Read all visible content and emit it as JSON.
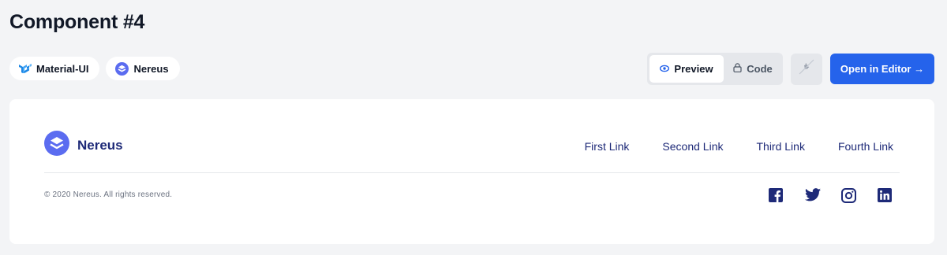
{
  "page": {
    "title": "Component #4"
  },
  "chips": [
    {
      "label": "Material-UI",
      "icon": "material-ui-logo-icon"
    },
    {
      "label": "Nereus",
      "icon": "nereus-logo-icon"
    }
  ],
  "toolbar": {
    "preview_label": "Preview",
    "code_label": "Code",
    "dark_mode_icon": "mode-toggle-icon",
    "open_editor_label": "Open in Editor →"
  },
  "footer": {
    "brand_name": "Nereus",
    "links": [
      "First Link",
      "Second Link",
      "Third Link",
      "Fourth Link"
    ],
    "copyright": "© 2020 Nereus. All rights reserved.",
    "social": [
      "facebook-icon",
      "twitter-icon",
      "instagram-icon",
      "linkedin-icon"
    ]
  },
  "colors": {
    "accent": "#2563eb",
    "brand_navy": "#1e2a78",
    "background": "#f3f4f6",
    "brand_logo": "#5b6cf0"
  }
}
